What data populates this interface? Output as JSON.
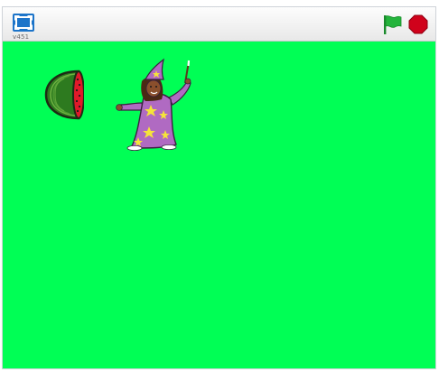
{
  "player": {
    "version_label": "v451",
    "stage_color": "#00ff55",
    "icons": {
      "fullscreen": "fullscreen-icon",
      "green_flag": "green-flag-icon",
      "stop": "stop-icon"
    },
    "colors": {
      "flag": "#24b43c",
      "stop": "#d0021b",
      "fullscreen": "#1c74c9"
    }
  },
  "stage": {
    "sprites": [
      {
        "name": "watermelon",
        "kind": "watermelon-half-sprite"
      },
      {
        "name": "wizard",
        "kind": "wizard-girl-sprite"
      }
    ]
  }
}
